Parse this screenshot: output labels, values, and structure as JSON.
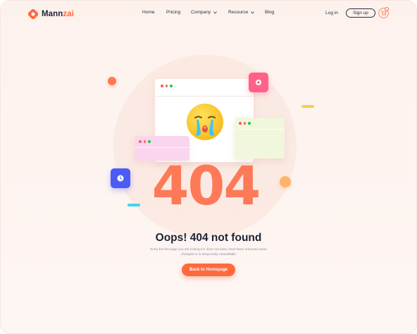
{
  "brand": {
    "name_part1": "Mann",
    "name_part2": "zai",
    "accent_color": "#ff6a3d",
    "icon": "logo-mark-icon"
  },
  "nav": {
    "items": [
      {
        "label": "Home",
        "has_dropdown": false
      },
      {
        "label": "Pricing",
        "has_dropdown": false
      },
      {
        "label": "Company",
        "has_dropdown": true
      },
      {
        "label": "Resource",
        "has_dropdown": true
      },
      {
        "label": "Blog",
        "has_dropdown": false
      }
    ]
  },
  "auth": {
    "login_label": "Log in",
    "signup_label": "Sign up"
  },
  "cart": {
    "icon": "cart-icon",
    "badge": "0"
  },
  "illustration": {
    "error_code": "404",
    "emoji": "crying-face-icon",
    "colors": {
      "circle": "#fbe4dc",
      "number": "#ff6a45",
      "tile_pink": "#ff6188",
      "tile_blue": "#4b5cf5",
      "window_pink": "#f9d6ee",
      "window_green": "#f0f7dc"
    }
  },
  "content": {
    "title": "Oops! 404 not found",
    "description": "Sorry but the page you are looking for does not exist, have been removed.name changed or is temporarily unavailable",
    "button_label": "Back to Homepage"
  }
}
